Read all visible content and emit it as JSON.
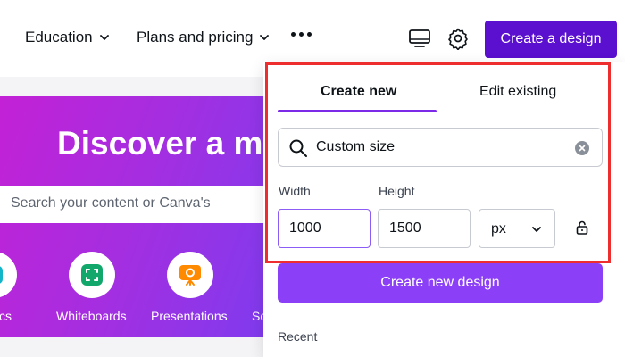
{
  "nav": {
    "education": "Education",
    "plans": "Plans and pricing",
    "create_design": "Create a design"
  },
  "hero": {
    "title": "Discover a ma",
    "search_placeholder": "Search your content or Canva's",
    "categories": [
      {
        "label": "cs",
        "icon": "doc-icon"
      },
      {
        "label": "Whiteboards",
        "icon": "whiteboard-icon"
      },
      {
        "label": "Presentations",
        "icon": "presentation-icon"
      },
      {
        "label": "So",
        "icon": "social-icon"
      }
    ]
  },
  "panel": {
    "tabs": [
      "Create new",
      "Edit existing"
    ],
    "search_value": "Custom size",
    "width_label": "Width",
    "height_label": "Height",
    "width_value": "1000",
    "height_value": "1500",
    "unit": "px",
    "create_button": "Create new design",
    "recent_label": "Recent"
  },
  "colors": {
    "brand": "#5b0fcf",
    "accent": "#8b3ff6",
    "highlight": "#ee2e2e"
  }
}
